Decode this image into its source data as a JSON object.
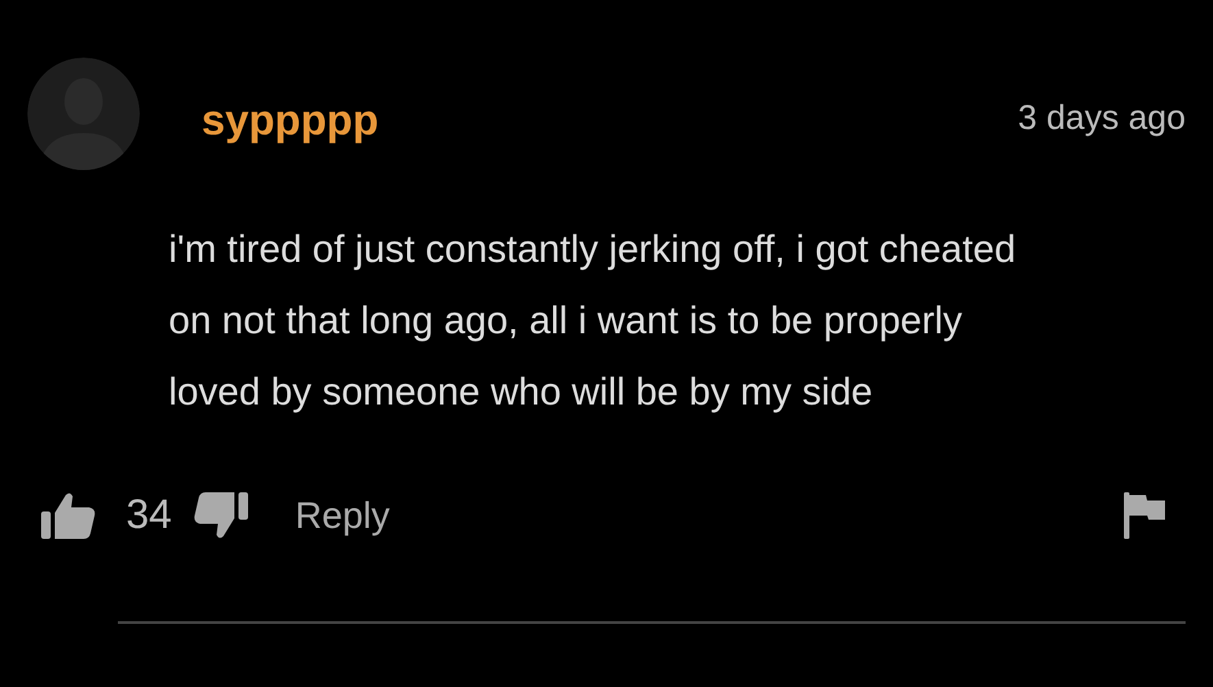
{
  "comment": {
    "username": "syppppp",
    "time": "3 days ago",
    "text": "i'm tired of just constantly jerking off, i got cheated on not that long ago, all i want is to be properly loved by someone who will be by my side",
    "likes": "34",
    "reply": "Reply"
  }
}
